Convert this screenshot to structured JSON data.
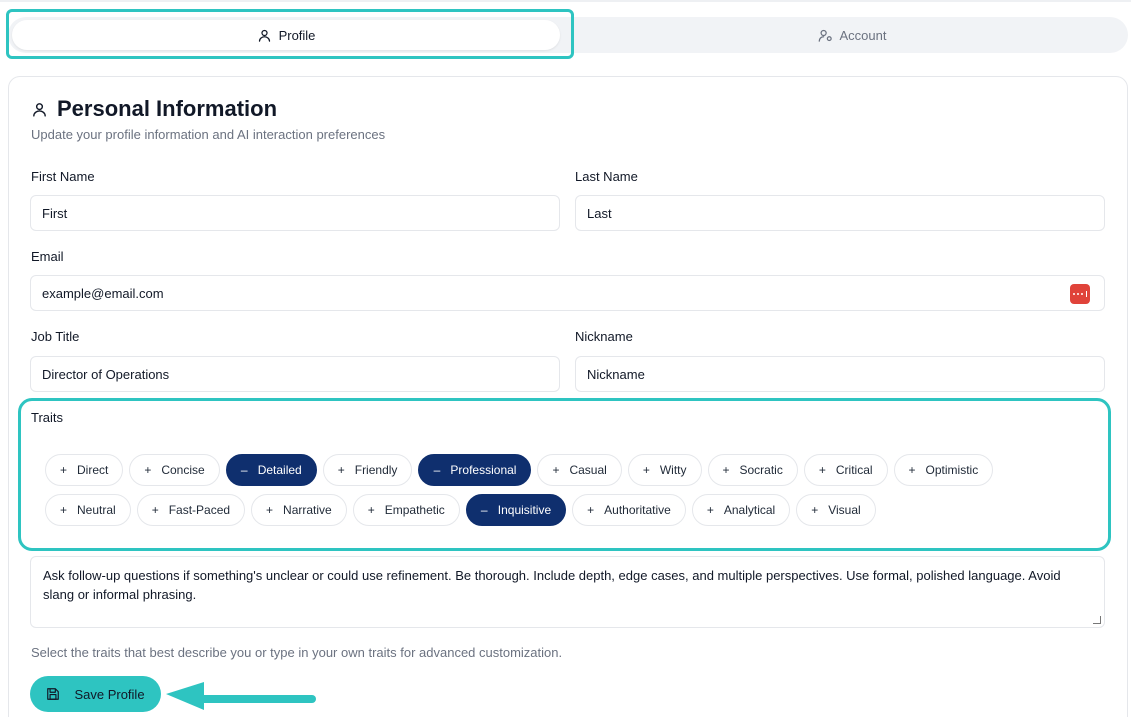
{
  "tabs": [
    {
      "label": "Profile",
      "icon": "user-icon",
      "active": true
    },
    {
      "label": "Account",
      "icon": "user-cog-icon",
      "active": false
    }
  ],
  "section": {
    "title": "Personal Information",
    "subtitle": "Update your profile information and AI interaction preferences"
  },
  "form": {
    "first_name": {
      "label": "First Name",
      "value": "First"
    },
    "last_name": {
      "label": "Last Name",
      "value": "Last"
    },
    "email": {
      "label": "Email",
      "value": "example@email.com"
    },
    "job_title": {
      "label": "Job Title",
      "value": "Director of Operations"
    },
    "nickname": {
      "label": "Nickname",
      "value": "Nickname"
    }
  },
  "traits": {
    "label": "Traits",
    "items": [
      {
        "label": "Direct",
        "selected": false
      },
      {
        "label": "Concise",
        "selected": false
      },
      {
        "label": "Detailed",
        "selected": true
      },
      {
        "label": "Friendly",
        "selected": false
      },
      {
        "label": "Professional",
        "selected": true
      },
      {
        "label": "Casual",
        "selected": false
      },
      {
        "label": "Witty",
        "selected": false
      },
      {
        "label": "Socratic",
        "selected": false
      },
      {
        "label": "Critical",
        "selected": false
      },
      {
        "label": "Optimistic",
        "selected": false
      },
      {
        "label": "Neutral",
        "selected": false
      },
      {
        "label": "Fast-Paced",
        "selected": false
      },
      {
        "label": "Narrative",
        "selected": false
      },
      {
        "label": "Empathetic",
        "selected": false
      },
      {
        "label": "Inquisitive",
        "selected": true
      },
      {
        "label": "Authoritative",
        "selected": false
      },
      {
        "label": "Analytical",
        "selected": false
      },
      {
        "label": "Visual",
        "selected": false
      }
    ],
    "description": "Ask follow-up questions if something's unclear or could use refinement. Be thorough. Include depth, edge cases, and multiple perspectives. Use formal, polished language. Avoid slang or informal phrasing.",
    "hint": "Select the traits that best describe you or type in your own traits for advanced customization."
  },
  "save_button": {
    "label": "Save Profile",
    "icon": "save-icon"
  },
  "colors": {
    "accent": "#2ec4c1",
    "selected_chip": "#0f2f6e",
    "password_manager": "#e0433a"
  }
}
